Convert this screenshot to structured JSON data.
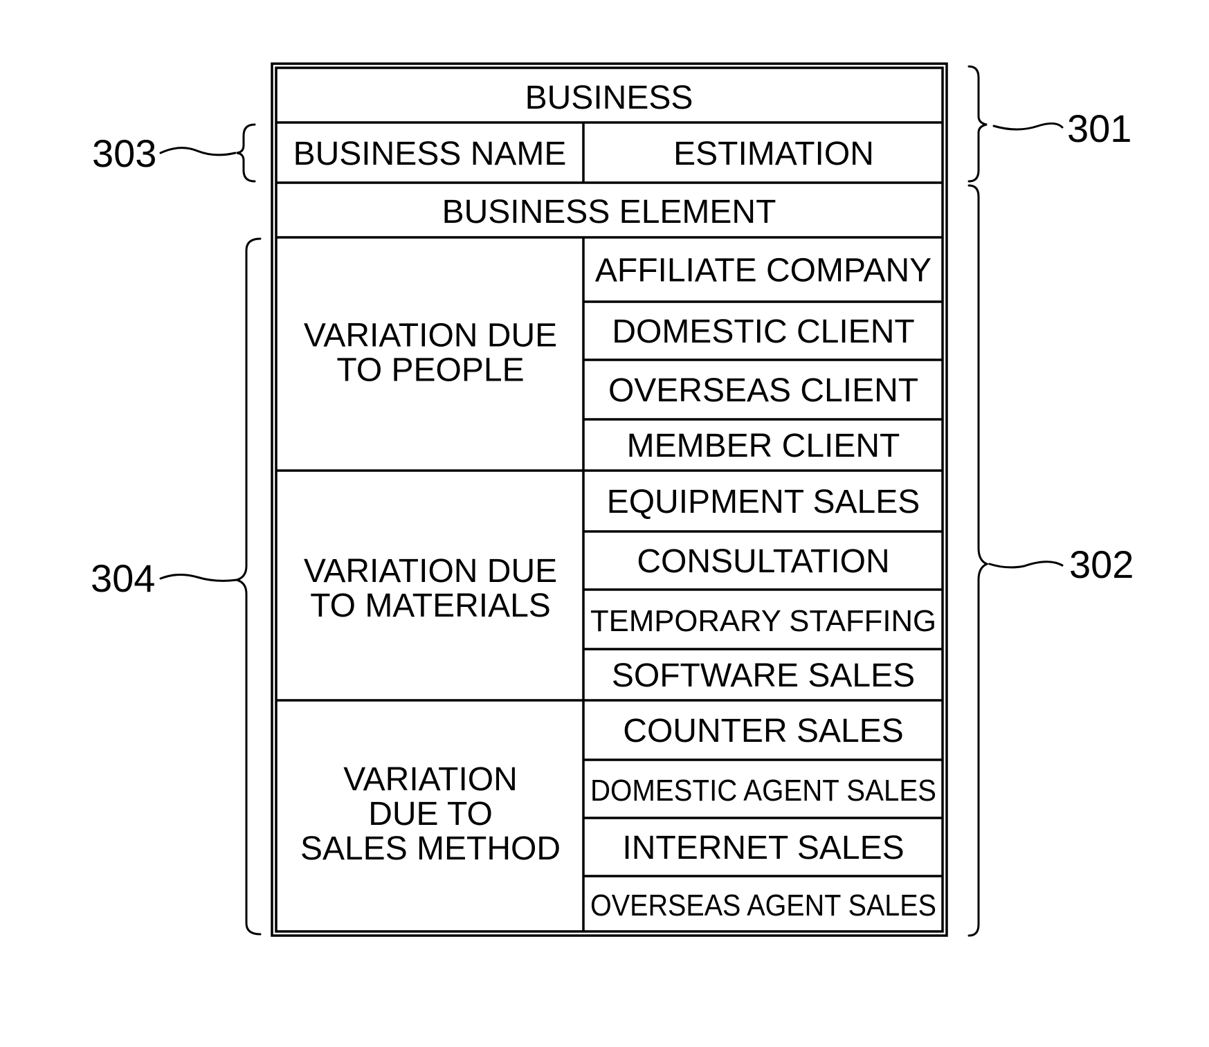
{
  "table": {
    "title": "BUSINESS",
    "header": {
      "business_name": "BUSINESS NAME",
      "estimation": "ESTIMATION"
    },
    "element_header": "BUSINESS ELEMENT",
    "groups": [
      {
        "label_lines": [
          "VARIATION DUE",
          "TO PEOPLE"
        ],
        "items": [
          "AFFILIATE COMPANY",
          "DOMESTIC CLIENT",
          "OVERSEAS CLIENT",
          "MEMBER CLIENT"
        ]
      },
      {
        "label_lines": [
          "VARIATION DUE",
          "TO MATERIALS"
        ],
        "items": [
          "EQUIPMENT SALES",
          "CONSULTATION",
          "TEMPORARY STAFFING",
          "SOFTWARE SALES"
        ]
      },
      {
        "label_lines": [
          "VARIATION",
          "DUE TO",
          "SALES METHOD"
        ],
        "items": [
          "COUNTER SALES",
          "DOMESTIC AGENT SALES",
          "INTERNET SALES",
          "OVERSEAS AGENT SALES"
        ]
      }
    ]
  },
  "annotations": {
    "ref_301": "301",
    "ref_302": "302",
    "ref_303": "303",
    "ref_304": "304"
  }
}
